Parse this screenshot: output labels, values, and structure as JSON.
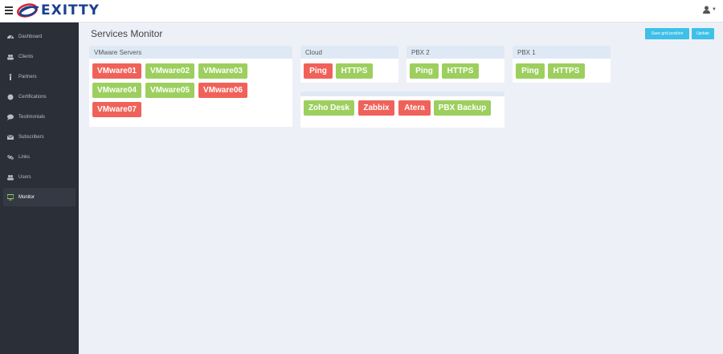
{
  "brand": {
    "logo_text": "EXITTY"
  },
  "page": {
    "title": "Services Monitor"
  },
  "actions": {
    "save_grid": "Save grid position",
    "update": "Update"
  },
  "sidebar": {
    "items": [
      {
        "label": "Dashboard",
        "icon": "dashboard-icon"
      },
      {
        "label": "Clients",
        "icon": "users-icon"
      },
      {
        "label": "Partners",
        "icon": "male-icon"
      },
      {
        "label": "Certifications",
        "icon": "certificate-icon"
      },
      {
        "label": "Testimonials",
        "icon": "comment-icon"
      },
      {
        "label": "Subscribers",
        "icon": "envelope-icon"
      },
      {
        "label": "Links",
        "icon": "link-icon"
      },
      {
        "label": "Users",
        "icon": "users-icon"
      },
      {
        "label": "Monitor",
        "icon": "desktop-icon",
        "active": true
      }
    ]
  },
  "panels": {
    "vmware": {
      "title": "VMware Servers",
      "items": [
        {
          "label": "VMware01",
          "status": "down"
        },
        {
          "label": "VMware02",
          "status": "up"
        },
        {
          "label": "VMware03",
          "status": "up"
        },
        {
          "label": "VMware04",
          "status": "up"
        },
        {
          "label": "VMware05",
          "status": "up"
        },
        {
          "label": "VMware06",
          "status": "down"
        },
        {
          "label": "VMware07",
          "status": "down"
        }
      ]
    },
    "cloud": {
      "title": "Cloud",
      "items": [
        {
          "label": "Ping",
          "status": "down"
        },
        {
          "label": "HTTPS",
          "status": "up"
        }
      ]
    },
    "pbx2": {
      "title": "PBX 2",
      "items": [
        {
          "label": "Ping",
          "status": "up"
        },
        {
          "label": "HTTPS",
          "status": "up"
        }
      ]
    },
    "pbx1": {
      "title": "PBX 1",
      "items": [
        {
          "label": "Ping",
          "status": "up"
        },
        {
          "label": "HTTPS",
          "status": "up"
        }
      ]
    },
    "misc": {
      "title": "",
      "items": [
        {
          "label": "Zoho Desk",
          "status": "up"
        },
        {
          "label": "Zabbix",
          "status": "down"
        },
        {
          "label": "Atera",
          "status": "down"
        },
        {
          "label": "PBX Backup",
          "status": "up"
        }
      ]
    }
  },
  "colors": {
    "up": "#9ccf5e",
    "down": "#f06259",
    "accent": "#3ec0e8",
    "sidebar_bg": "#2a2f38"
  }
}
